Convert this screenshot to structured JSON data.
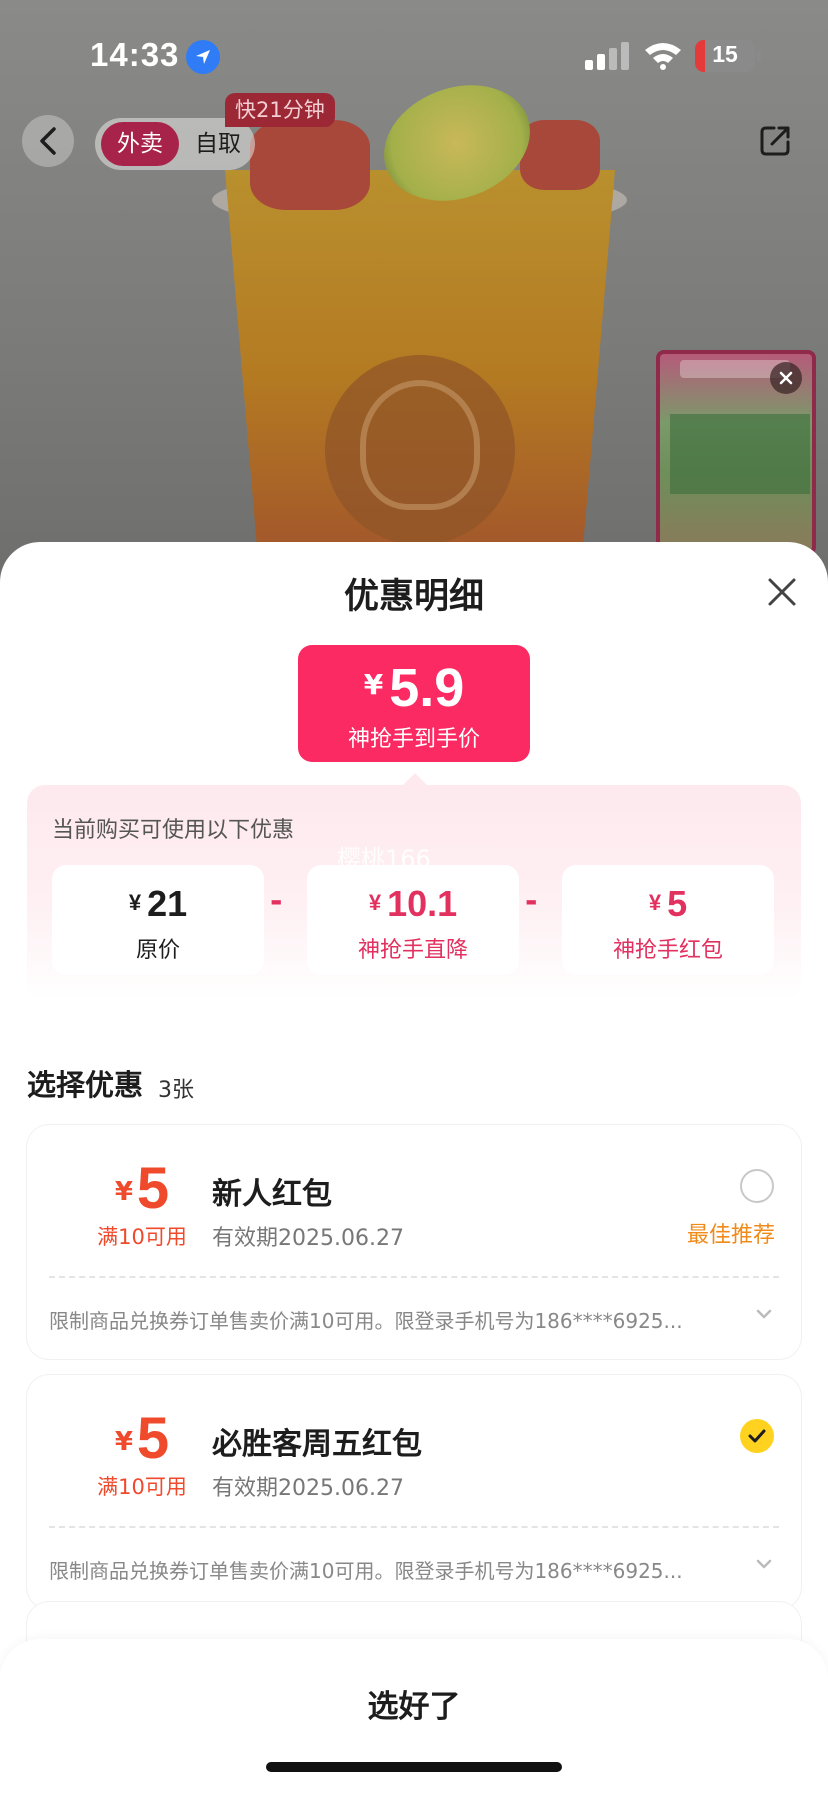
{
  "status_bar": {
    "time": "14:33",
    "battery": "15"
  },
  "nav": {
    "delivery": "外卖",
    "pickup": "自取",
    "fast_badge": "快21分钟"
  },
  "sheet": {
    "title": "优惠明细",
    "price": {
      "currency": "¥",
      "value": "5.9",
      "label": "神抢手到手价"
    },
    "discount_hint": "当前购买可使用以下优惠",
    "watermark": "樱桃166",
    "breakdown": [
      {
        "currency": "¥",
        "amount": "21",
        "label": "原价"
      },
      {
        "currency": "¥",
        "amount": "10.1",
        "label": "神抢手直降"
      },
      {
        "currency": "¥",
        "amount": "5",
        "label": "神抢手红包"
      }
    ],
    "minus_sign": "-",
    "select_title": "选择优惠",
    "select_count": "3张",
    "coupons": [
      {
        "currency": "¥",
        "amount": "5",
        "condition": "满10可用",
        "name": "新人红包",
        "expiry": "有效期2025.06.27",
        "recommend": "最佳推荐",
        "selected": false,
        "desc": "限制商品兑换券订单售卖价满10可用。限登录手机号为186****6925..."
      },
      {
        "currency": "¥",
        "amount": "5",
        "condition": "满10可用",
        "name": "必胜客周五红包",
        "expiry": "有效期2025.06.27",
        "recommend": "",
        "selected": true,
        "desc": "限制商品兑换券订单售卖价满10可用。限登录手机号为186****6925..."
      }
    ],
    "confirm": "选好了"
  },
  "colors": {
    "accent_pink": "#fc2a62",
    "coupon_red": "#f04a2d",
    "recommend_orange": "#f08b1a",
    "check_yellow": "#ffd21f"
  }
}
